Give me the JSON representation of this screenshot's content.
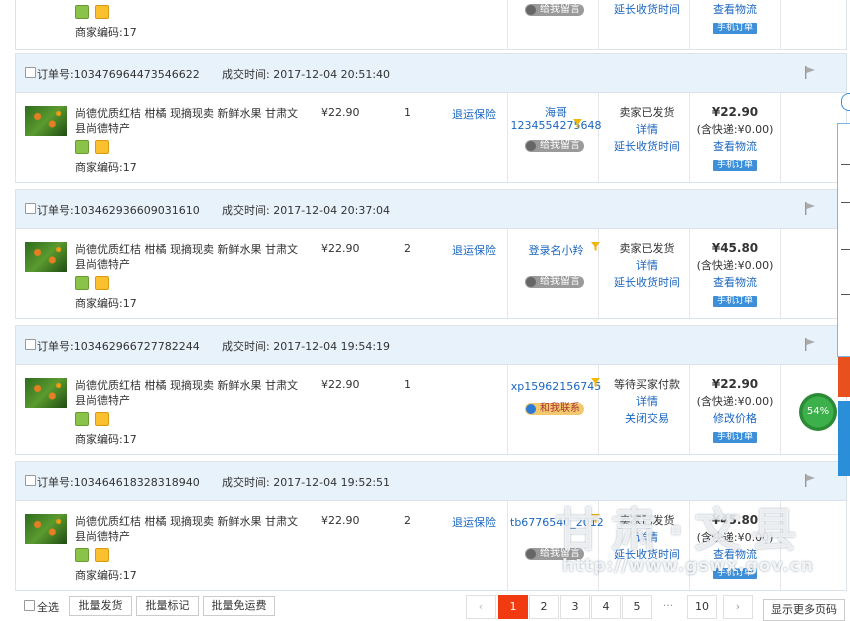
{
  "labels": {
    "order_no": "订单号:",
    "deal_time": "成交时间:",
    "merchant_code": "商家编码:",
    "leave_msg": "给我留言",
    "contact_me": "和我联系",
    "shipping_incl": "(含快递:¥0.00)",
    "view_logistics": "查看物流",
    "manual_order": "手机订单",
    "return_insurance": "退运保险",
    "details": "详情",
    "extend_receipt": "延长收货时间"
  },
  "top_partial": {
    "merchant_code": "17",
    "leave_msg": "给我留言",
    "extend": "延长收货时间",
    "logistics": "查看物流",
    "manual": "手机订单"
  },
  "orders": [
    {
      "order_no": "103476964473546622",
      "time": "2017-12-04 20:51:40",
      "title": "尚德优质红桔 柑橘 现摘现卖 新鲜水果 甘肃文县尚德特产",
      "merchant_code": "17",
      "price": "¥22.90",
      "qty": "1",
      "insurance": "退运保险",
      "buyer": "海哥1234554275648",
      "msg": "给我留言",
      "status": "卖家已发货",
      "detail": "详情",
      "action": "延长收货时间",
      "total": "¥22.90",
      "shipping": "(含快递:¥0.00)",
      "logistics": "查看物流",
      "manual": "手机订单"
    },
    {
      "order_no": "103462936609031610",
      "time": "2017-12-04 20:37:04",
      "title": "尚德优质红桔 柑橘 现摘现卖 新鲜水果 甘肃文县尚德特产",
      "merchant_code": "17",
      "price": "¥22.90",
      "qty": "2",
      "insurance": "退运保险",
      "buyer": "登录名小羚",
      "msg": "给我留言",
      "status": "卖家已发货",
      "detail": "详情",
      "action": "延长收货时间",
      "total": "¥45.80",
      "shipping": "(含快递:¥0.00)",
      "logistics": "查看物流",
      "manual": "手机订单"
    },
    {
      "order_no": "103462966727782244",
      "time": "2017-12-04 19:54:19",
      "title": "尚德优质红桔 柑橘 现摘现卖 新鲜水果 甘肃文县尚德特产",
      "merchant_code": "17",
      "price": "¥22.90",
      "qty": "1",
      "insurance": "",
      "buyer": "xp15962156745",
      "msg": "和我联系",
      "status": "等待买家付款",
      "detail": "详情",
      "action": "关闭交易",
      "total": "¥22.90",
      "shipping": "(含快递:¥0.00)",
      "logistics": "修改价格",
      "manual": "手机订单"
    },
    {
      "order_no": "103464618328318940",
      "time": "2017-12-04 19:52:51",
      "title": "尚德优质红桔 柑橘 现摘现卖 新鲜水果 甘肃文县尚德特产",
      "merchant_code": "17",
      "price": "¥22.90",
      "qty": "2",
      "insurance": "退运保险",
      "buyer": "tb6776540_2012",
      "msg": "给我留言",
      "status": "卖家已发货",
      "detail": "详情",
      "action": "延长收货时间",
      "total": "¥45.80",
      "shipping": "(含快递:¥0.00)",
      "logistics": "查看物流",
      "manual": "手机订单"
    }
  ],
  "bottom": {
    "select_all": "全选",
    "batch_ship": "批量发货",
    "batch_mark": "批量标记",
    "batch_free_shipping": "批量免运费",
    "show_more": "显示更多页码",
    "prev": "‹",
    "next": "›",
    "pages": [
      "1",
      "2",
      "3",
      "4",
      "5",
      "···",
      "10"
    ]
  },
  "gauge": {
    "value": "54%",
    "level": 0.54
  },
  "watermark": {
    "text": "甘肃·文县",
    "url": "http://www.gswx.gov.cn"
  },
  "colors": {
    "header_bg": "#e8f2fb",
    "link": "#1a66c0",
    "active_page": "#f23a10",
    "gauge": "#3cb04a"
  }
}
